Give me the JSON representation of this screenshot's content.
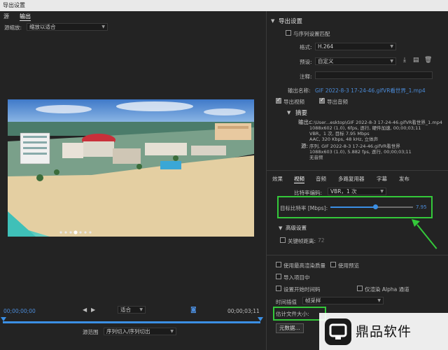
{
  "window": {
    "title": "导出设置"
  },
  "tabs": [
    {
      "label": "源"
    },
    {
      "label": "输出"
    }
  ],
  "source": {
    "scaling_label": "源缩放:",
    "scaling_value": "缩放以适合"
  },
  "video_overlay": {
    "pager_dots": 7,
    "active_dot": 3
  },
  "timeline": {
    "timecode_start": "00;00;00;00",
    "fit_label": "适合",
    "timecode_end": "00;00;03;11",
    "range_label": "源范围",
    "range_value": "序列切入/序列切出"
  },
  "export_settings": {
    "section_title": "导出设置",
    "match_sequence_label": "与序列设置匹配",
    "format_label": "格式:",
    "format_value": "H.264",
    "preset_label": "预设:",
    "preset_value": "自定义",
    "comment_label": "注释:",
    "comment_value": "",
    "output_name_label": "输出名称:",
    "output_name_value": "GIF 2022-8-3 17-24-46.gifVR看世界_1.mp4",
    "export_video_label": "导出视频",
    "export_audio_label": "导出音频"
  },
  "summary": {
    "title": "摘要",
    "output_label": "输出:",
    "output_lines": [
      "C:\\User...esktop\\GIF 2022-8-3 17-24-46.gifVR看世界_1.mp4",
      "1088x602 (1.0), 6fps, 逐行, 硬件加速, 00;00;03;11",
      "VBR，1 次, 目标 7.95 Mbps",
      "AAC, 320 Kbps, 48 kHz, 立体声"
    ],
    "source_label": "源:",
    "source_lines": [
      "序列, GIF 2022-8-3 17-24-46.gifVR看世界",
      "1088x603 (1.0), 5.882 fps, 逐行, 00;00;03;11",
      "无音频"
    ]
  },
  "panel_tabs": [
    {
      "label": "效果"
    },
    {
      "label": "视频"
    },
    {
      "label": "音频"
    },
    {
      "label": "多路复用器"
    },
    {
      "label": "字幕"
    },
    {
      "label": "发布"
    }
  ],
  "bitrate": {
    "encoding_label": "比特率编码:",
    "encoding_value": "VBR，1 次",
    "target_label": "目标比特率 [Mbps]:",
    "target_value": "7.95",
    "slider_fraction": 0.55
  },
  "advanced": {
    "title": "高级设置",
    "keyframe_label": "关键帧距离:",
    "keyframe_value": "72"
  },
  "bottom_options": {
    "max_render_quality": "使用最高渲染质量",
    "use_previews": "使用预览",
    "import_into_project": "导入项目中",
    "set_start_timecode": "设置开始时间码",
    "render_alpha_only": "仅渲染 Alpha 通道",
    "time_interpolation_label": "时间插值",
    "time_interpolation_value": "帧采样",
    "estimated_file_size_label": "估计文件大小:",
    "metadata_button": "元数据..."
  },
  "watermark": {
    "text": "鼎品软件"
  },
  "colors": {
    "background": "#232323",
    "accent_blue": "#3b8fe4",
    "highlight_green": "#34c93a",
    "link_blue": "#4b8bd8"
  },
  "icons": [
    "chevron-down-icon",
    "save-preset-icon",
    "import-preset-icon",
    "delete-preset-icon",
    "play-icon",
    "mark-in-icon",
    "mark-out-icon",
    "export-frame-icon"
  ]
}
